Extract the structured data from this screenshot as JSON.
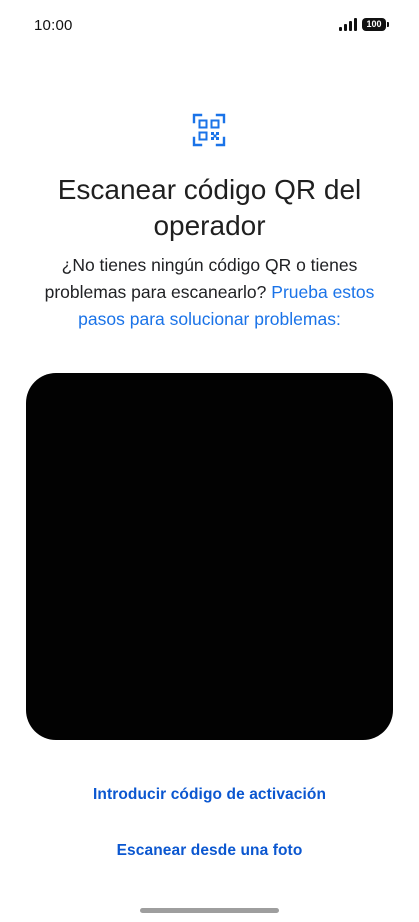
{
  "status_bar": {
    "time": "10:00",
    "battery_level": "100",
    "icons": [
      "signal-icon",
      "battery-icon"
    ]
  },
  "header": {
    "icon": "qr-code-scan-icon",
    "title": "Escanear código QR del operador",
    "subtitle_text": "¿No tienes ningún código QR o tienes problemas para escanearlo?",
    "subtitle_link": "Prueba estos pasos para solucionar problemas:"
  },
  "actions": {
    "enter_code": "Introducir código de activación",
    "scan_from_photo": "Escanear desde una foto"
  },
  "colors": {
    "accent": "#1a73e8",
    "link": "#0b57d0",
    "viewfinder": "#020202",
    "text": "#1f1f1f"
  }
}
